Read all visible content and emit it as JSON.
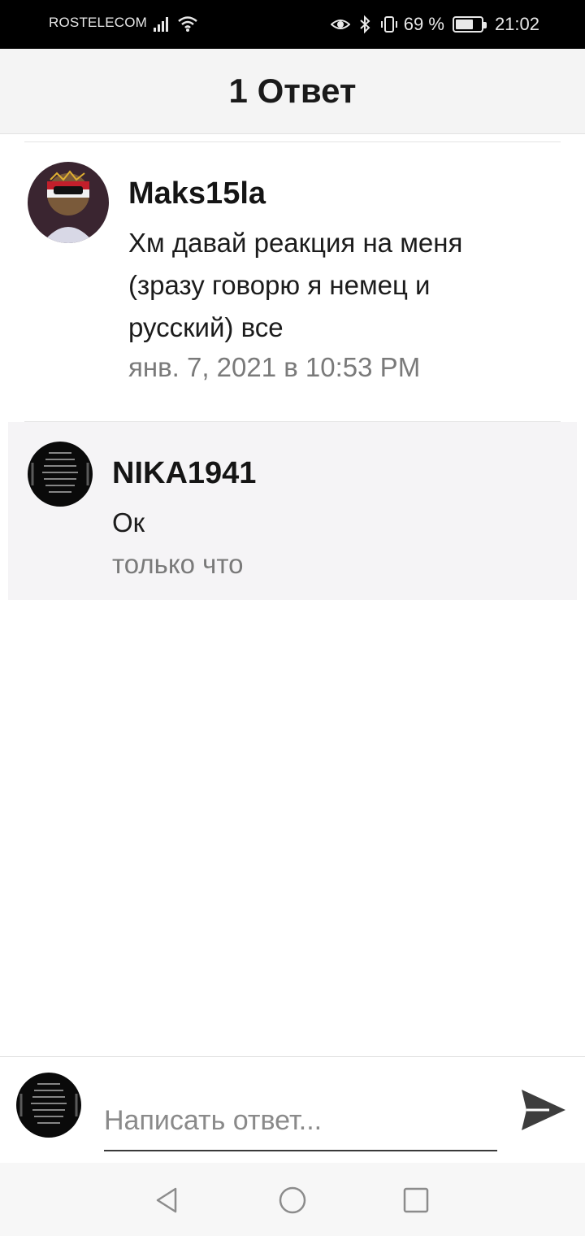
{
  "status_bar": {
    "carrier": "ROSTELECOM",
    "battery_text": "69 %",
    "battery_level": 0.69,
    "time": "21:02",
    "icons": [
      "signal-icon",
      "wifi-icon",
      "eye-icon",
      "bluetooth-icon",
      "vibrate-icon",
      "battery-icon"
    ]
  },
  "header": {
    "title": "1 Ответ"
  },
  "comment": {
    "author": "Maks15la",
    "text": "Хм давай реакция на меня (зразу говорю я немец и русский) все",
    "timestamp": "янв. 7, 2021 в 10:53 PM"
  },
  "reply": {
    "author": "NIKA1941",
    "text": "Ок",
    "timestamp": "только что"
  },
  "composer": {
    "placeholder": "Написать ответ...",
    "value": ""
  },
  "colors": {
    "header_bg": "#f4f4f4",
    "reply_bg": "#f5f4f6",
    "timestamp": "#7a7a7a",
    "send_icon": "#3d3d3d"
  }
}
